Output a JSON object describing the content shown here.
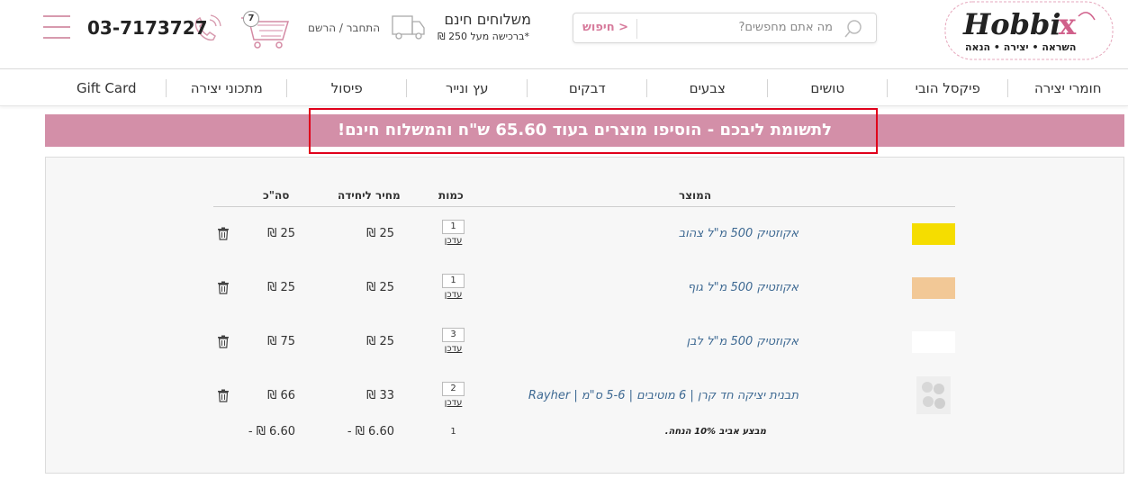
{
  "header": {
    "logo": {
      "brand": "Hobbix",
      "tagline": "השראה • יצירה • הנאה"
    },
    "search": {
      "placeholder": "מה אתם מחפשים?",
      "button_label": "חיפוש >"
    },
    "shipping": {
      "title": "משלוחים חינם",
      "subtitle": "*ברכישה מעל 250 ₪"
    },
    "login_label": "התחבר / הרשם",
    "cart_count": "7",
    "phone": "03-7173727",
    "icons": [
      "search-icon",
      "truck-icon",
      "cart-icon",
      "phone-icon",
      "hamburger-menu-icon"
    ]
  },
  "nav": {
    "items": [
      {
        "label": "חומרי יצירה"
      },
      {
        "label": "פיקסל הובי"
      },
      {
        "label": "טושים"
      },
      {
        "label": "צבעים"
      },
      {
        "label": "דבקים"
      },
      {
        "label": "עץ ונייר"
      },
      {
        "label": "פיסול"
      },
      {
        "label": "מתכוני יצירה"
      },
      {
        "label": "Gift Card"
      }
    ]
  },
  "banner": {
    "text": "לתשומת ליבכם - הוסיפו מוצרים בעוד 65.60 ש\"ח והמשלוח חינם!",
    "color": "#d38fa8",
    "highlight_color": "#e0001b"
  },
  "cart": {
    "columns": {
      "product": "המוצר",
      "quantity": "כמות",
      "unit_price": "מחיר ליחידה",
      "total": "סה\"כ"
    },
    "update_label": "עדכן",
    "items": [
      {
        "title": "אקוזטיק 500 מ\"ל צהוב",
        "quantity": "1",
        "unit_price": "25 ₪",
        "total": "25 ₪",
        "swatch": "#f5dd00"
      },
      {
        "title": "אקוזטיק 500 מ\"ל גוף",
        "quantity": "1",
        "unit_price": "25 ₪",
        "total": "25 ₪",
        "swatch": "#f2c896"
      },
      {
        "title": "אקוזטיק 500 מ\"ל לבן",
        "quantity": "3",
        "unit_price": "25 ₪",
        "total": "75 ₪",
        "swatch": "#ffffff"
      },
      {
        "title": "תבנית יציקה חד קרן | 6 מוטיבים | 5-6 ס\"מ | Rayher",
        "quantity": "2",
        "unit_price": "33 ₪",
        "total": "66 ₪",
        "swatch": "#e4e4e4"
      }
    ],
    "promotion": {
      "label": "מבצע אביב 10% הנחה.",
      "quantity": "1",
      "unit_price": "6.60 ₪ -",
      "total": "6.60 ₪ -"
    }
  }
}
